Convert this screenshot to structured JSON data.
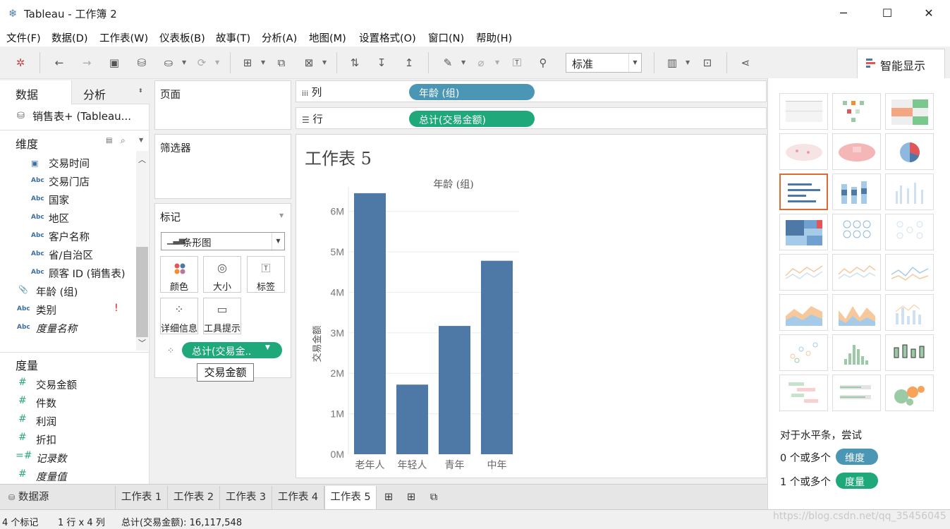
{
  "window": {
    "title": "Tableau - 工作簿 2",
    "app_icon": "tableau-logo-icon",
    "controls": {
      "minimize": "─",
      "maximize": "☐",
      "close": "✕"
    }
  },
  "menubar": [
    "文件(F)",
    "数据(D)",
    "工作表(W)",
    "仪表板(B)",
    "故事(T)",
    "分析(A)",
    "地图(M)",
    "设置格式(O)",
    "窗口(N)",
    "帮助(H)"
  ],
  "toolbar": {
    "fit_value": "标准",
    "icons": [
      "tableau-icon",
      "back-icon",
      "forward-icon",
      "save-icon",
      "new-datasource-icon",
      "pause-updates-icon",
      "refresh-icon",
      "new-sheet-icon",
      "duplicate-sheet-icon",
      "clear-sheet-icon",
      "swap-icon",
      "sort-ascending-icon",
      "sort-descending-icon",
      "highlight-icon",
      "group-icon",
      "show-labels-icon",
      "pin-icon",
      "show-cards-icon",
      "presentation-icon",
      "share-icon"
    ]
  },
  "showme": {
    "tab_label": "智能显示"
  },
  "datapane": {
    "tab_data": "数据",
    "tab_analysis": "分析",
    "datasource": "销售表+ (Tableau...",
    "dimensions_header": "维度",
    "dimensions": [
      {
        "type": "cal",
        "label": "交易时间"
      },
      {
        "type": "Abc",
        "label": "交易门店"
      },
      {
        "type": "Abc",
        "label": "国家"
      },
      {
        "type": "Abc",
        "label": "地区"
      },
      {
        "type": "Abc",
        "label": "客户名称"
      },
      {
        "type": "Abc",
        "label": "省/自治区"
      },
      {
        "type": "Abc",
        "label": "顾客 ID (销售表)"
      },
      {
        "type": "clip",
        "label": "年龄 (组)"
      },
      {
        "type": "Abc",
        "label": "类别",
        "warning": "!"
      },
      {
        "type": "Abc",
        "label": "度量名称"
      }
    ],
    "measures_header": "度量",
    "measures": [
      {
        "type": "#",
        "label": "交易金额"
      },
      {
        "type": "#",
        "label": "件数"
      },
      {
        "type": "#",
        "label": "利润"
      },
      {
        "type": "#",
        "label": "折扣"
      },
      {
        "type": "=#",
        "label": "记录数"
      },
      {
        "type": "#",
        "label": "度量值"
      }
    ]
  },
  "cards": {
    "pages": "页面",
    "filters": "筛选器",
    "marks": "标记",
    "mark_type": "条形图",
    "mark_buttons": [
      "颜色",
      "大小",
      "标签",
      "详细信息",
      "工具提示"
    ],
    "mark_pill": "总计(交易金..",
    "tooltip": "交易金额"
  },
  "shelves": {
    "columns_label": "列",
    "columns_pill": "年龄 (组)",
    "rows_label": "行",
    "rows_pill": "总计(交易金额)"
  },
  "sheet_title": "工作表 5",
  "chart_data": {
    "type": "bar",
    "title": "年龄 (组)",
    "ylabel": "交易金额",
    "categories": [
      "老年人",
      "年轻人",
      "青年",
      "中年"
    ],
    "values": [
      6450000,
      1720000,
      3170000,
      4780000
    ],
    "ylim": [
      0,
      6500000
    ],
    "yticks": [
      0,
      1000000,
      2000000,
      3000000,
      4000000,
      5000000,
      6000000
    ],
    "ytick_labels": [
      "0M",
      "1M",
      "2M",
      "3M",
      "4M",
      "5M",
      "6M"
    ],
    "color": "#4e79a7",
    "grid": true
  },
  "sheet_tabs": {
    "datasource": "数据源",
    "tabs": [
      "工作表 1",
      "工作表 2",
      "工作表 3",
      "工作表 4",
      "工作表 5"
    ],
    "active": "工作表 5"
  },
  "status": {
    "marks": "4 个标记",
    "rows_cols": "1 行 x 4 列",
    "sum": "总计(交易金额): 16,117,548"
  },
  "showme_hints": {
    "line1": "对于水平条，尝试",
    "dim_count": "0 个或多个",
    "dim_pill": "维度",
    "mea_count": "1 个或多个",
    "mea_pill": "度量"
  },
  "watermark": "https://blog.csdn.net/qq_35456045"
}
